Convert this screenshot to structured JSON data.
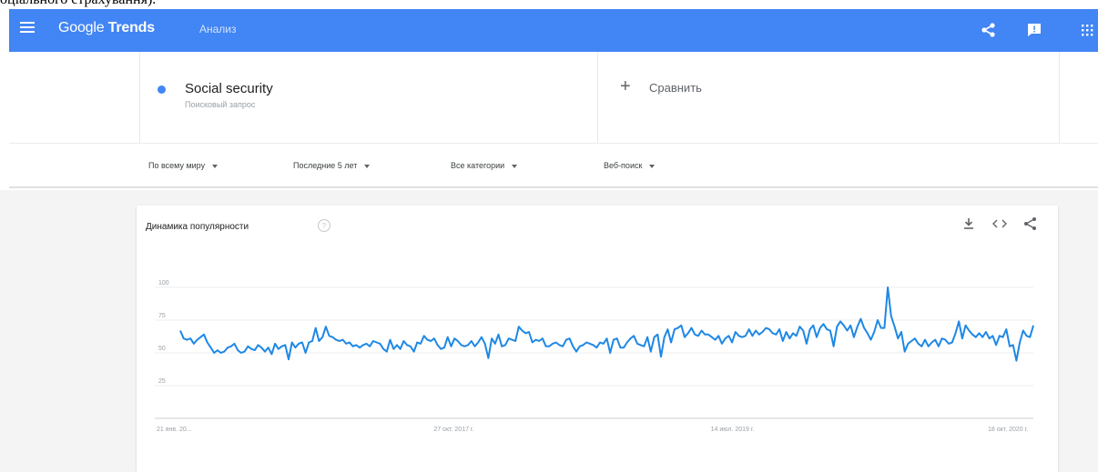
{
  "page": {
    "caption": "оціального страхування)."
  },
  "appbar": {
    "logo_google": "Google",
    "logo_trends": "Trends",
    "section": "Анализ",
    "colors": {
      "bar": "#4285f4"
    },
    "icons": [
      "menu-icon",
      "share-icon",
      "feedback-icon",
      "apps-icon"
    ]
  },
  "search": {
    "term": "Social security",
    "term_type": "Поисковый запрос",
    "term_color": "#4285f4",
    "compare_label": "Сравнить"
  },
  "filters": [
    {
      "label": "По всему миру"
    },
    {
      "label": "Последние 5 лет"
    },
    {
      "label": "Все категории"
    },
    {
      "label": "Веб-поиск"
    }
  ],
  "card": {
    "title": "Динамика популярности",
    "actions": [
      "download-icon",
      "embed-icon",
      "share-icon"
    ]
  },
  "chart_data": {
    "type": "line",
    "title": "Динамика популярности",
    "xlabel": "",
    "ylabel": "",
    "ylim": [
      0,
      100
    ],
    "yticks": [
      "100",
      "75",
      "50",
      "25"
    ],
    "xtick_labels": [
      "21 янв. 20...",
      "27 окт. 2017 г.",
      "14 июл. 2019 г.",
      "18 окт. 2020 г."
    ],
    "series_color": "#1e88e5",
    "series": [
      {
        "name": "Social security",
        "values": [
          67,
          61,
          60,
          61,
          57,
          60,
          62,
          64,
          58,
          54,
          50,
          52,
          50,
          51,
          54,
          55,
          57,
          52,
          50,
          51,
          55,
          53,
          52,
          56,
          54,
          51,
          54,
          49,
          57,
          53,
          55,
          56,
          45,
          58,
          54,
          57,
          58,
          50,
          58,
          59,
          69,
          59,
          62,
          70,
          63,
          62,
          60,
          59,
          60,
          57,
          58,
          55,
          56,
          54,
          56,
          57,
          55,
          59,
          58,
          57,
          53,
          51,
          60,
          53,
          56,
          53,
          59,
          56,
          55,
          51,
          58,
          57,
          63,
          60,
          59,
          61,
          56,
          53,
          54,
          62,
          55,
          61,
          59,
          56,
          55,
          56,
          59,
          55,
          58,
          62,
          57,
          46,
          61,
          57,
          64,
          55,
          56,
          61,
          60,
          59,
          70,
          67,
          65,
          66,
          58,
          60,
          59,
          61,
          55,
          55,
          57,
          58,
          56,
          55,
          60,
          61,
          55,
          51,
          55,
          56,
          58,
          57,
          56,
          54,
          58,
          57,
          61,
          50,
          60,
          61,
          54,
          54,
          58,
          61,
          63,
          57,
          56,
          55,
          62,
          51,
          62,
          64,
          47,
          62,
          68,
          58,
          68,
          69,
          71,
          62,
          65,
          69,
          64,
          63,
          67,
          64,
          64,
          62,
          60,
          63,
          57,
          61,
          63,
          58,
          66,
          63,
          62,
          63,
          68,
          63,
          67,
          64,
          66,
          69,
          68,
          65,
          64,
          68,
          59,
          66,
          61,
          65,
          63,
          70,
          67,
          57,
          68,
          71,
          62,
          69,
          72,
          68,
          67,
          55,
          70,
          74,
          71,
          67,
          71,
          62,
          70,
          76,
          69,
          65,
          60,
          66,
          75,
          69,
          69,
          100,
          78,
          70,
          61,
          66,
          51,
          57,
          59,
          61,
          57,
          55,
          60,
          55,
          58,
          60,
          55,
          61,
          60,
          57,
          58,
          65,
          74,
          61,
          71,
          67,
          64,
          62,
          65,
          62,
          66,
          61,
          63,
          56,
          63,
          62,
          68,
          55,
          56,
          44,
          58,
          67,
          63,
          62,
          71
        ]
      }
    ]
  }
}
